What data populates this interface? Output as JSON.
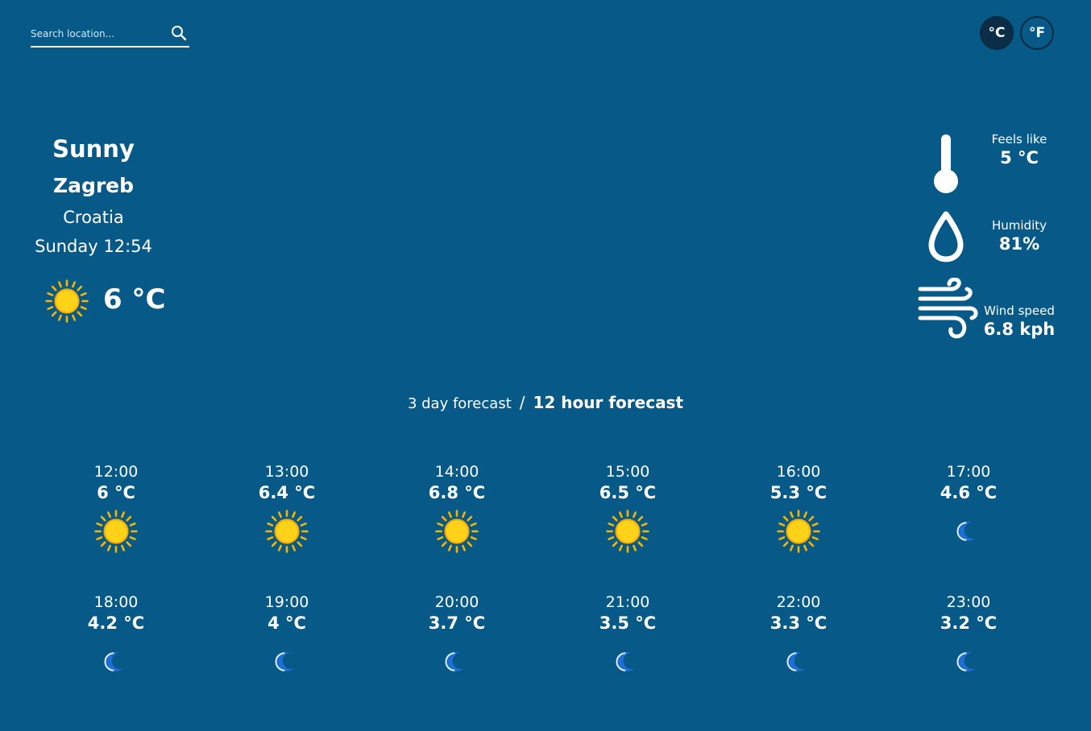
{
  "search": {
    "placeholder": "Search location..."
  },
  "units": {
    "celsius_label": "°C",
    "fahrenheit_label": "°F",
    "selected": "°C"
  },
  "current": {
    "condition": "Sunny",
    "city": "Zagreb",
    "country": "Croatia",
    "datetime": "Sunday 12:54",
    "temperature": "6 °C",
    "icon": "sun-icon"
  },
  "stats": {
    "feels_like": {
      "label": "Feels like",
      "value": "5 °C",
      "icon": "thermometer-icon"
    },
    "humidity": {
      "label": "Humidity",
      "value": "81%",
      "icon": "droplet-icon"
    },
    "wind": {
      "label": "Wind speed",
      "value": "6.8 kph",
      "icon": "wind-icon"
    }
  },
  "forecast_toggle": {
    "three_day": "3 day forecast",
    "separator": "/",
    "twelve_hour": "12 hour forecast",
    "selected": "12 hour forecast"
  },
  "hourly": [
    {
      "time": "12:00",
      "temp": "6 °C",
      "icon": "sun-icon"
    },
    {
      "time": "13:00",
      "temp": "6.4 °C",
      "icon": "sun-icon"
    },
    {
      "time": "14:00",
      "temp": "6.8 °C",
      "icon": "sun-icon"
    },
    {
      "time": "15:00",
      "temp": "6.5 °C",
      "icon": "sun-icon"
    },
    {
      "time": "16:00",
      "temp": "5.3 °C",
      "icon": "sun-icon"
    },
    {
      "time": "17:00",
      "temp": "4.6 °C",
      "icon": "moon-icon"
    },
    {
      "time": "18:00",
      "temp": "4.2 °C",
      "icon": "moon-icon"
    },
    {
      "time": "19:00",
      "temp": "4 °C",
      "icon": "moon-icon"
    },
    {
      "time": "20:00",
      "temp": "3.7 °C",
      "icon": "moon-icon"
    },
    {
      "time": "21:00",
      "temp": "3.5 °C",
      "icon": "moon-icon"
    },
    {
      "time": "22:00",
      "temp": "3.3 °C",
      "icon": "moon-icon"
    },
    {
      "time": "23:00",
      "temp": "3.2 °C",
      "icon": "moon-icon"
    }
  ],
  "colors": {
    "background": "#075987",
    "sun": "#f7b500",
    "moon": "#1d6fd8",
    "selected_unit_bg": "#0b2d47"
  }
}
